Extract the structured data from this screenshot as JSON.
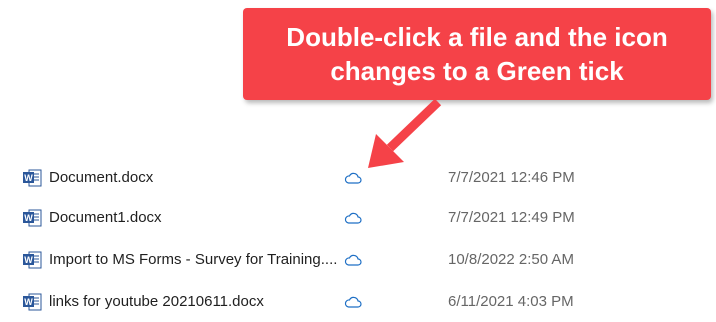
{
  "callout": {
    "line1": "Double-click a file and the icon",
    "line2": "changes to a Green tick",
    "color": "#f54248"
  },
  "files": [
    {
      "name": "Document.docx",
      "status_icon": "cloud-icon",
      "modified": "7/7/2021 12:46 PM",
      "type_icon": "word-doc-icon"
    },
    {
      "name": "Document1.docx",
      "status_icon": "cloud-icon",
      "modified": "7/7/2021 12:49 PM",
      "type_icon": "word-doc-icon"
    },
    {
      "name": "Import to MS Forms - Survey for Training....",
      "status_icon": "cloud-icon",
      "modified": "10/8/2022 2:50 AM",
      "type_icon": "word-doc-icon"
    },
    {
      "name": "links for youtube 20210611.docx",
      "status_icon": "cloud-icon",
      "modified": "6/11/2021 4:03 PM",
      "type_icon": "word-doc-icon"
    }
  ],
  "colors": {
    "word_blue": "#2b579a",
    "cloud_blue": "#1e6fc5",
    "date_gray": "#666666"
  }
}
